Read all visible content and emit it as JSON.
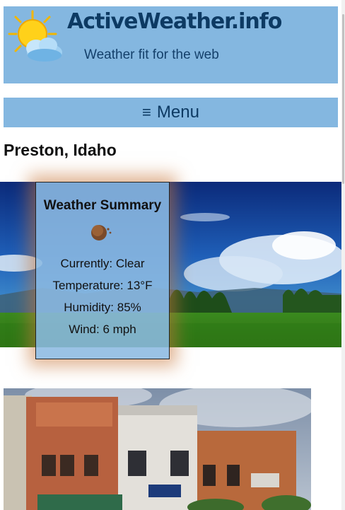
{
  "header": {
    "site_title": "ActiveWeather.info",
    "tagline": "Weather fit for the web",
    "logo_icon": "sun-cloud-icon"
  },
  "menu": {
    "label": "Menu",
    "icon": "hamburger-icon",
    "glyph": "≡"
  },
  "location": "Preston, Idaho",
  "summary": {
    "title": "Weather Summary",
    "icon": "moon-icon",
    "currently": "Currently: Clear",
    "temperature": "Temperature: 13°F",
    "humidity": "Humidity: 85%",
    "wind": "Wind: 6 mph"
  },
  "colors": {
    "header_bg": "#84b7e0",
    "title_text": "#0d3a63"
  }
}
